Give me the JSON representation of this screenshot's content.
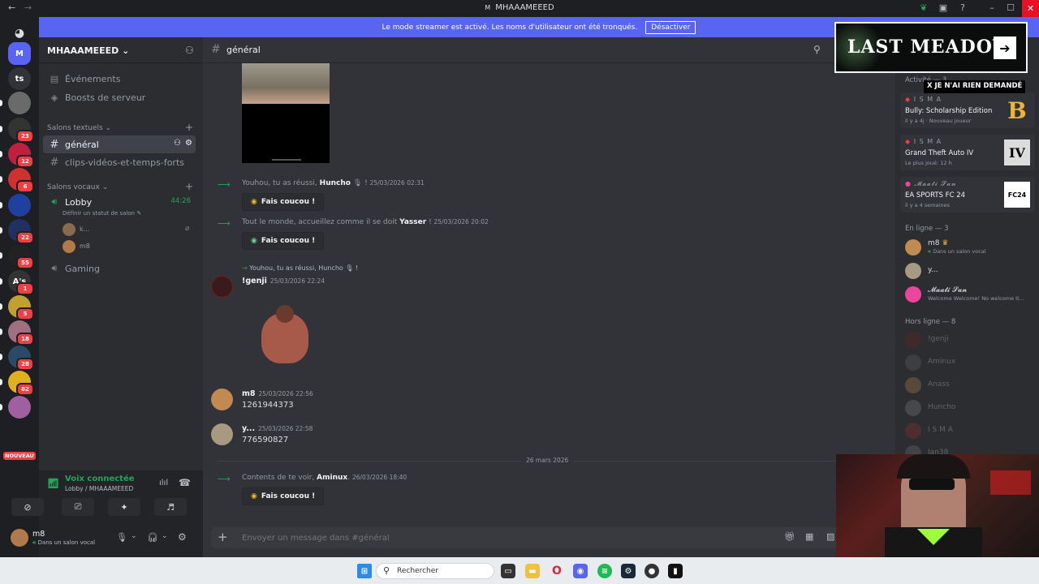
{
  "window": {
    "title": "MHAAAMEEED",
    "app_initial": "M"
  },
  "banner": {
    "text": "Le mode streamer est activé. Les noms d'utilisateur ont été tronqués.",
    "button": "Désactiver"
  },
  "servers": [
    {
      "label": "",
      "badge": "",
      "icon": "discord-icon"
    },
    {
      "label": "M",
      "badge": "",
      "icon": "server-m"
    },
    {
      "label": "ts",
      "badge": "",
      "icon": "server-ts"
    },
    {
      "label": "",
      "badge": "",
      "icon": "server-avatar"
    },
    {
      "label": "",
      "badge": "23",
      "icon": "server-avatar"
    },
    {
      "label": "",
      "badge": "12",
      "icon": "server-avatar"
    },
    {
      "label": "",
      "badge": "6",
      "icon": "server-avatar"
    },
    {
      "label": "",
      "badge": "",
      "icon": "server-avatar"
    },
    {
      "label": "",
      "badge": "22",
      "icon": "server-avatar"
    },
    {
      "label": "",
      "badge": "55",
      "icon": "server-avatar"
    },
    {
      "label": "A's",
      "badge": "1",
      "icon": "server-avatar"
    },
    {
      "label": "",
      "badge": "5",
      "icon": "server-avatar"
    },
    {
      "label": "",
      "badge": "18",
      "icon": "server-avatar"
    },
    {
      "label": "",
      "badge": "28",
      "icon": "server-avatar"
    },
    {
      "label": "",
      "badge": "82",
      "icon": "server-avatar"
    },
    {
      "label": "",
      "badge": "",
      "icon": "server-avatar"
    }
  ],
  "servers_new_label": "NOUVEAU",
  "sidebar": {
    "server_name": "MHAAAMEEED",
    "events": "Événements",
    "boosts": "Boosts de serveur",
    "text_category": "Salons textuels",
    "text_channels": [
      "général",
      "clips-vidéos-et-temps-forts"
    ],
    "voice_category": "Salons vocaux",
    "voice_channel": "Lobby",
    "voice_timer": "44:26",
    "voice_status": "Définir un statut de salon",
    "voice_users": [
      "k...",
      "m8"
    ],
    "voice_channel_2": "Gaming"
  },
  "voice_panel": {
    "status": "Voix connectée",
    "location": "Lobby / MHAAAMEEED"
  },
  "user_panel": {
    "name": "m8",
    "status": "Dans un salon vocal"
  },
  "header": {
    "channel": "général"
  },
  "messages": {
    "sys1": {
      "text": "Youhou, tu as réussi,",
      "user": "Huncho",
      "tail": "!",
      "time": "25/03/2026 02:31"
    },
    "wave1": "Fais coucou !",
    "sys2": {
      "text": "Tout le monde, accueillez comme il se doit",
      "user": "Yasser",
      "tail": "!",
      "time": "25/03/2026 20:02"
    },
    "wave2": "Fais coucou !",
    "reply": {
      "text": "Youhou, tu as réussi, Huncho",
      "tail": "!"
    },
    "genji": {
      "name": "!genji",
      "time": "25/03/2026 22:24"
    },
    "m8": {
      "name": "m8",
      "time": "25/03/2026 22:56",
      "text": "1261944373"
    },
    "y": {
      "name": "y...",
      "time": "25/03/2026 22:58",
      "text": "776590827"
    },
    "divider": "26 mars 2026",
    "sys3": {
      "text": "Contents de te voir,",
      "user": "Aminux",
      "tail": ".",
      "time": "26/03/2026 18:40"
    },
    "wave3": "Fais coucou !"
  },
  "composer": {
    "placeholder": "Envoyer un message dans #général"
  },
  "members": {
    "activity_header": "Activité — 3",
    "activities": [
      {
        "name": "I S M A",
        "game": "Bully: Scholarship Edition",
        "sub": "il y a 4j · Nouveau joueur",
        "art": "B"
      },
      {
        "name": "I S M A",
        "game": "Grand Theft Auto IV",
        "sub": "Le plus joué: 12 h",
        "art": "IV"
      },
      {
        "name": "𝓜𝓪𝓪𝓽𝓲 𝓢𝓪𝓷",
        "game": "EA SPORTS FC 24",
        "sub": "il y a 4 semaines",
        "art": "FC24"
      }
    ],
    "online_header": "En ligne — 3",
    "online": [
      {
        "name": "m8",
        "status": "Dans un salon vocal"
      },
      {
        "name": "y...",
        "status": ""
      },
      {
        "name": "𝓜𝓪𝓪𝓽𝓲 𝓢𝓪𝓷",
        "status": "Welcome Welcome! No welcome It..."
      }
    ],
    "offline_header": "Hors ligne — 8",
    "offline": [
      "!genji",
      "Aminux",
      "Anass",
      "Huncho",
      "I S M A",
      "Ian38"
    ]
  },
  "overlay": {
    "title": "LAST MEADOW",
    "arrow": "➔",
    "tagline": "X JE N'AI RIEN DEMANDÉ"
  },
  "taskbar": {
    "search": "Rechercher"
  },
  "colors": {
    "accent": "#5865f2",
    "green": "#23a55a",
    "red": "#f23f43",
    "bg_main": "#313338",
    "bg_side": "#2b2d31"
  }
}
